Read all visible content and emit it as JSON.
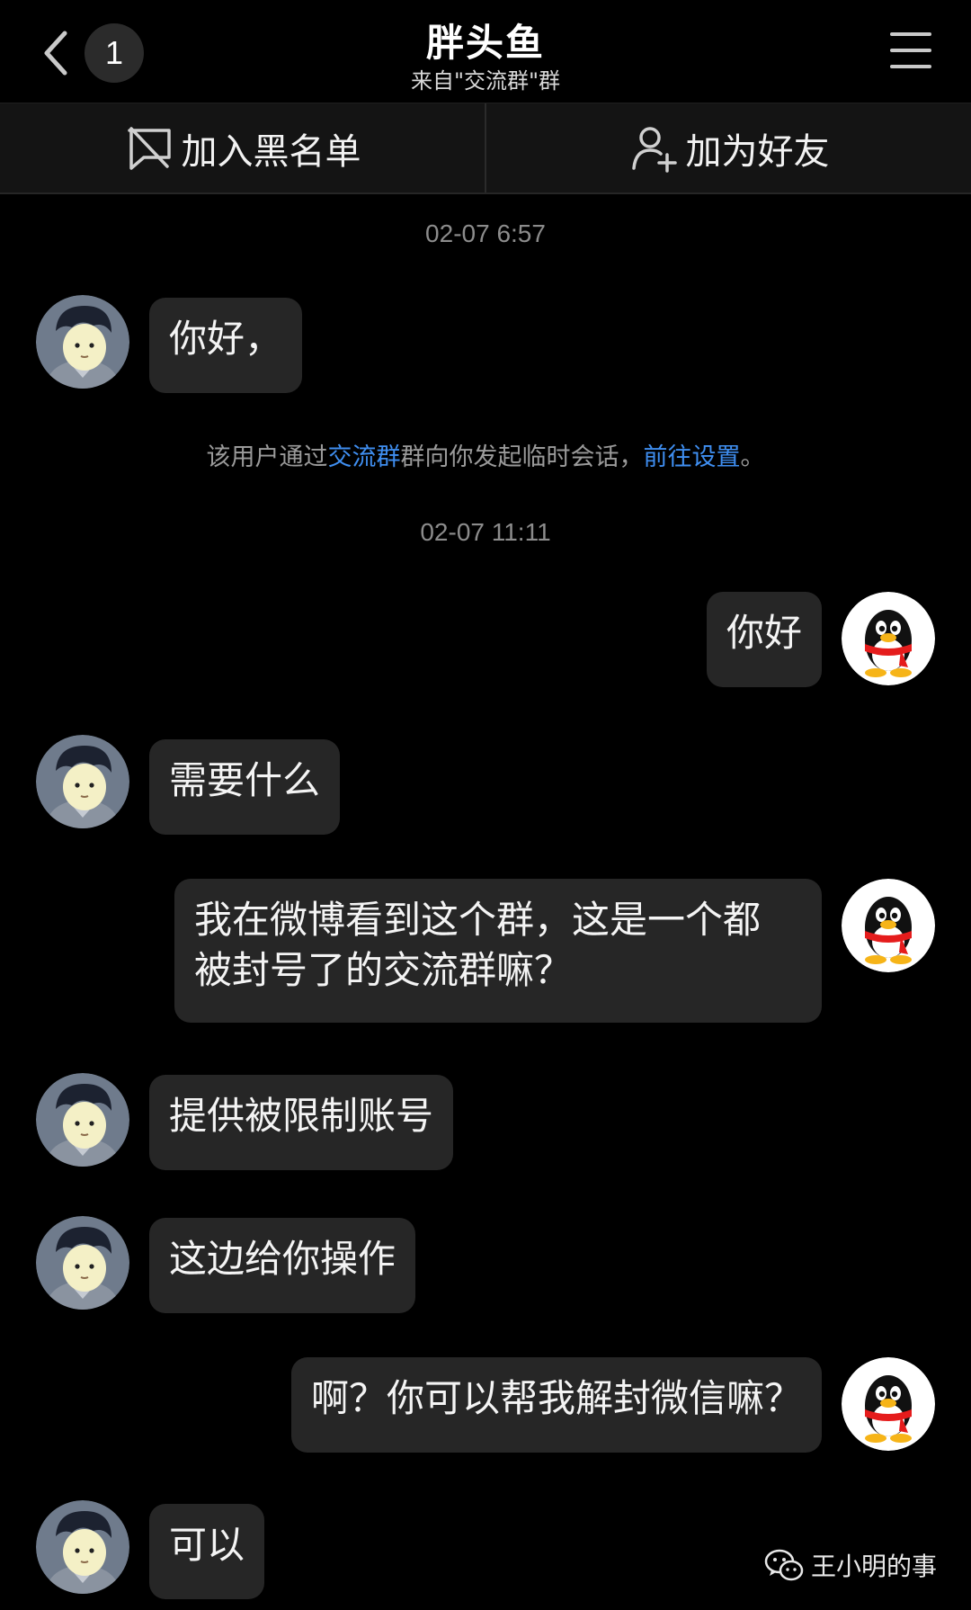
{
  "header": {
    "back_badge": "1",
    "title": "胖头鱼",
    "subtitle": "来自\"交流群\"群"
  },
  "actions": {
    "blacklist_label": "加入黑名单",
    "add_friend_label": "加为好友"
  },
  "chat": {
    "timestamp_1": "02-07 6:57",
    "timestamp_2": "02-07 11:11",
    "sysnote": {
      "prefix": "该用户通过",
      "group_link": "交流群",
      "middle": "群向你发起临时会话，",
      "settings_link": "前往设置",
      "suffix": "。"
    },
    "messages": [
      {
        "side": "left",
        "text": "你好，"
      },
      {
        "side": "right",
        "text": "你好"
      },
      {
        "side": "left",
        "text": "需要什么"
      },
      {
        "side": "right",
        "line1": "我在微博看到这个群，这是一个都",
        "line2": "被封号了的交流群嘛？"
      },
      {
        "side": "left",
        "text": "提供被限制账号"
      },
      {
        "side": "left",
        "text": "这边给你操作"
      },
      {
        "side": "right",
        "text": "啊？你可以帮我解封微信嘛？"
      },
      {
        "side": "left",
        "text": "可以"
      }
    ]
  },
  "watermark": {
    "text": "王小明的事"
  },
  "icons": {
    "back": "chevron-left-icon",
    "menu": "hamburger-menu-icon",
    "blacklist": "block-message-icon",
    "add_friend": "add-user-icon",
    "contact_avatar": "cartoon-boy-avatar",
    "self_avatar": "qq-penguin-avatar",
    "watermark": "wechat-icon"
  },
  "colors": {
    "background": "#000000",
    "bubble": "#262626",
    "link": "#3f8ef0"
  }
}
